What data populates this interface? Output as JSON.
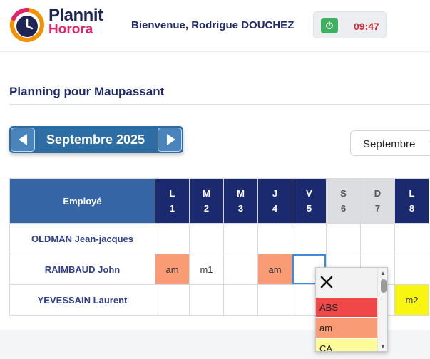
{
  "app": {
    "logo_word1": "Plannit",
    "logo_word2": "Horora",
    "welcome": "Bienvenue, Rodrigue DOUCHEZ",
    "clock_time": "09:47",
    "brand_colors": {
      "navy": "#1e2556",
      "pink": "#e0236b",
      "orange": "#f39200"
    }
  },
  "page": {
    "title": "Planning pour Maupassant",
    "month_label": "Septembre 2025",
    "month_select_value": "Septembre"
  },
  "table": {
    "employee_header": "Employé",
    "days": [
      {
        "letter": "L",
        "num": "1",
        "weekend": false
      },
      {
        "letter": "M",
        "num": "2",
        "weekend": false
      },
      {
        "letter": "M",
        "num": "3",
        "weekend": false
      },
      {
        "letter": "J",
        "num": "4",
        "weekend": false
      },
      {
        "letter": "V",
        "num": "5",
        "weekend": false
      },
      {
        "letter": "S",
        "num": "6",
        "weekend": true
      },
      {
        "letter": "D",
        "num": "7",
        "weekend": true
      },
      {
        "letter": "L",
        "num": "8",
        "weekend": false
      }
    ],
    "rows": [
      {
        "name": "OLDMAN Jean-jacques",
        "cells": [
          "",
          "",
          "",
          "",
          "",
          "",
          "",
          ""
        ]
      },
      {
        "name": "RAIMBAUD John",
        "cells": [
          "am",
          "m1",
          "",
          "am",
          "",
          "",
          "",
          ""
        ]
      },
      {
        "name": "YEVESSAIN Laurent",
        "cells": [
          "",
          "",
          "",
          "",
          "",
          "",
          "",
          "m2"
        ]
      }
    ]
  },
  "popup": {
    "options": [
      {
        "label": "ABS",
        "color": "#f04848"
      },
      {
        "label": "am",
        "color": "#f99c76"
      },
      {
        "label": "CA",
        "color": "#fbfb98"
      }
    ]
  },
  "icons": {
    "logo": "clock-logo-icon",
    "clock_button": "power-icon",
    "prev": "caret-left-icon",
    "next": "caret-right-icon",
    "close": "close-icon"
  }
}
